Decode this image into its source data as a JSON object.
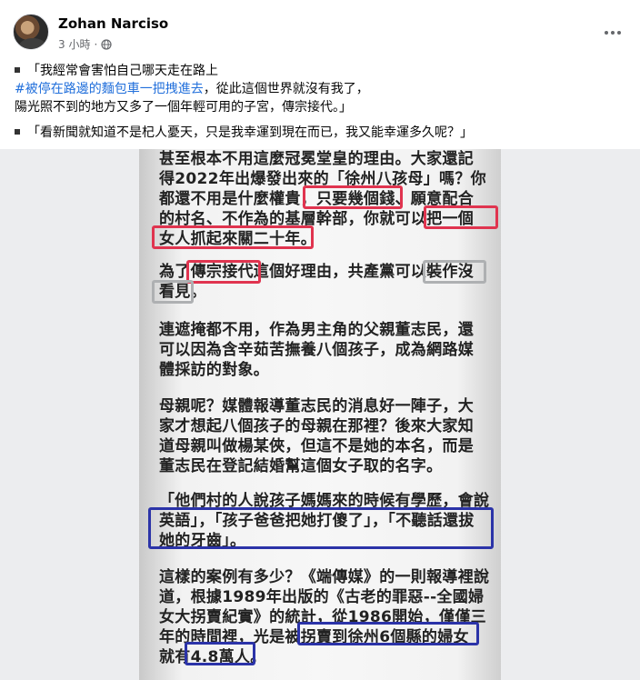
{
  "post": {
    "author": "Zohan Narciso",
    "time": "3 小時",
    "separator": "·",
    "globe_icon": "globe-icon",
    "more_icon": "more-options-icon"
  },
  "text": {
    "q1_line1": "「我經常會害怕自己哪天走在路上",
    "q1_hashtag": "#被停在路邊的麵包車一把拽進去",
    "q1_line2_rest": "，從此這個世界就沒有我了，",
    "q1_line3": "陽光照不到的地方又多了一個年輕可用的子宮，傳宗接代。」",
    "q2": "「看新聞就知道不是杞人憂天，只是我幸運到現在而已，我又能幸運多久呢？」"
  },
  "image_text": {
    "p1": [
      "甚至根本不用這麼冠冕堂皇的理由。大家還記",
      "得2022年出爆發出來的「徐州八孩母」嗎？你",
      "都還不用是什麼權貴，只要幾個錢、願意配合",
      "的村名、不作為的基層幹部，你就可以把一個",
      "女人抓起來關二十年。"
    ],
    "p2": [
      "為了傳宗接代這個好理由，共產黨可以裝作沒",
      "看見。"
    ],
    "p3": [
      "連遮掩都不用，作為男主角的父親董志民，還",
      "可以因為含辛茹苦撫養八個孩子，成為網路媒",
      "體採訪的對象。"
    ],
    "p4": [
      "母親呢？媒體報導董志民的消息好一陣子，大",
      "家才想起八個孩子的母親在那裡？後來大家知",
      "道母親叫做楊某俠，但這不是她的本名，而是",
      "董志民在登記結婚幫這個女子取的名字。"
    ],
    "p5": [
      "「他們村的人說孩子媽媽來的時候有學歷，會說",
      "英語」，「孩子爸爸把她打傻了」，「不聽話還拔",
      "她的牙齒」。"
    ],
    "p6": [
      "這樣的案例有多少？《端傳媒》的一則報導裡說",
      "道，根據1989年出版的《古老的罪惡--全國婦",
      "女大拐賣紀實》的統計，從1986開始，僅僅三",
      "年的時間裡，光是被拐賣到徐州6個縣的婦女",
      "就有4.8萬人。"
    ]
  },
  "colors": {
    "highlight_red": "#e0344f",
    "highlight_gray": "#aeb0b2",
    "highlight_blue": "#2b33a8",
    "hashtag": "#216fdb"
  }
}
